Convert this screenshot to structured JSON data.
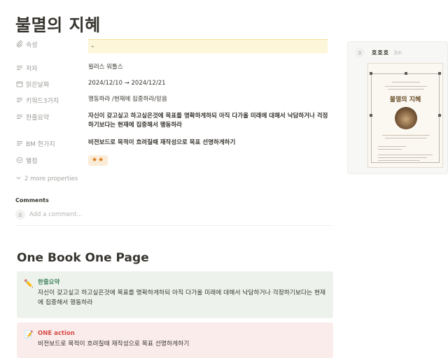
{
  "page": {
    "title": "불멸의 지혜"
  },
  "properties": {
    "attr": {
      "label": "속성",
      "value_icon": "tag-icon"
    },
    "author": {
      "label": "저자",
      "value": "윌러스 워틀스"
    },
    "read_date": {
      "label": "읽은날짜",
      "value": "2024/12/10 → 2024/12/21"
    },
    "keywords": {
      "label": "키워드3가지",
      "value": "행동하라 /현재에 집중하라/믿음"
    },
    "summary": {
      "label": "한줄요약",
      "value": "자신이 갖고싶고 하고싶은것에 목표를 명확하게하되 아직 다가올 미래에 대해서 낙담하거나 걱정하기보다는 현재에 집중해서 행동하라"
    },
    "bm": {
      "label": "BM 한가지",
      "value": "비전보드로 목적이 흐려질때 재작성으로 목표 선명하게하기"
    },
    "rating": {
      "label": "별점",
      "value": "★★"
    },
    "more": "2 more properties"
  },
  "comments": {
    "label": "Comments",
    "placeholder": "Add a comment..."
  },
  "section": {
    "heading": "One Book One Page"
  },
  "callouts": [
    {
      "icon": "pencil-icon",
      "glyph": "✏️",
      "title": "한줄요약",
      "body": "자신이 갖고싶고 하고싶은것에 목표를 명확하게하되 아직 다가올 미래에 대해서 낙담하거나 걱정하기보다는 현재에 집중해서 행동하라"
    },
    {
      "icon": "memo-icon",
      "glyph": "📝",
      "title": "ONE action",
      "body": "비전보드로 목적이 흐려질때 재작성으로 목표 선명하게하기"
    }
  ],
  "side_comment": {
    "author": "호호호",
    "time": "3m",
    "image": "book-cover-image",
    "book_title": "불멸의 지혜"
  },
  "colors": {
    "accent_green": "#448361",
    "accent_red": "#d44c47",
    "callout_green_bg": "#edf3ec",
    "callout_red_bg": "#fbecec",
    "attr_bg": "#fdf6d8"
  }
}
